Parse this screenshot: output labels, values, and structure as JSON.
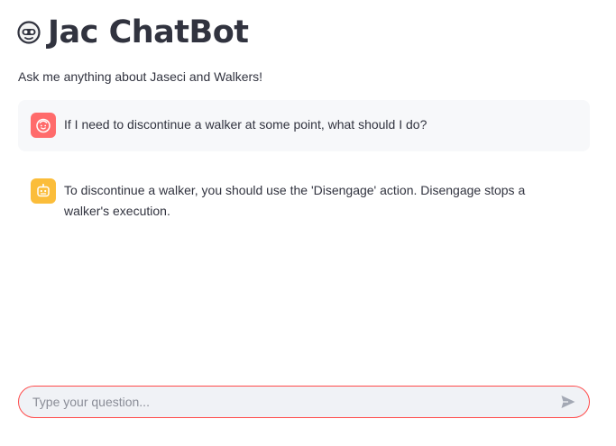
{
  "header": {
    "title": "Jac ChatBot",
    "icon": "robot-face-icon"
  },
  "subtitle": "Ask me anything about Jaseci and Walkers!",
  "messages": [
    {
      "role": "user",
      "avatar": "user-face-icon",
      "avatar_color": "#ff6b6b",
      "text": "If I need to discontinue a walker at some point, what should I do?"
    },
    {
      "role": "assistant",
      "avatar": "bot-icon",
      "avatar_color": "#fbbd3a",
      "text": "To discontinue a walker, you should use the 'Disengage' action. Disengage stops a walker's execution."
    }
  ],
  "chat_input": {
    "placeholder": "Type your question...",
    "value": "",
    "border_color": "#ff4b4b",
    "send_icon": "send-icon"
  }
}
